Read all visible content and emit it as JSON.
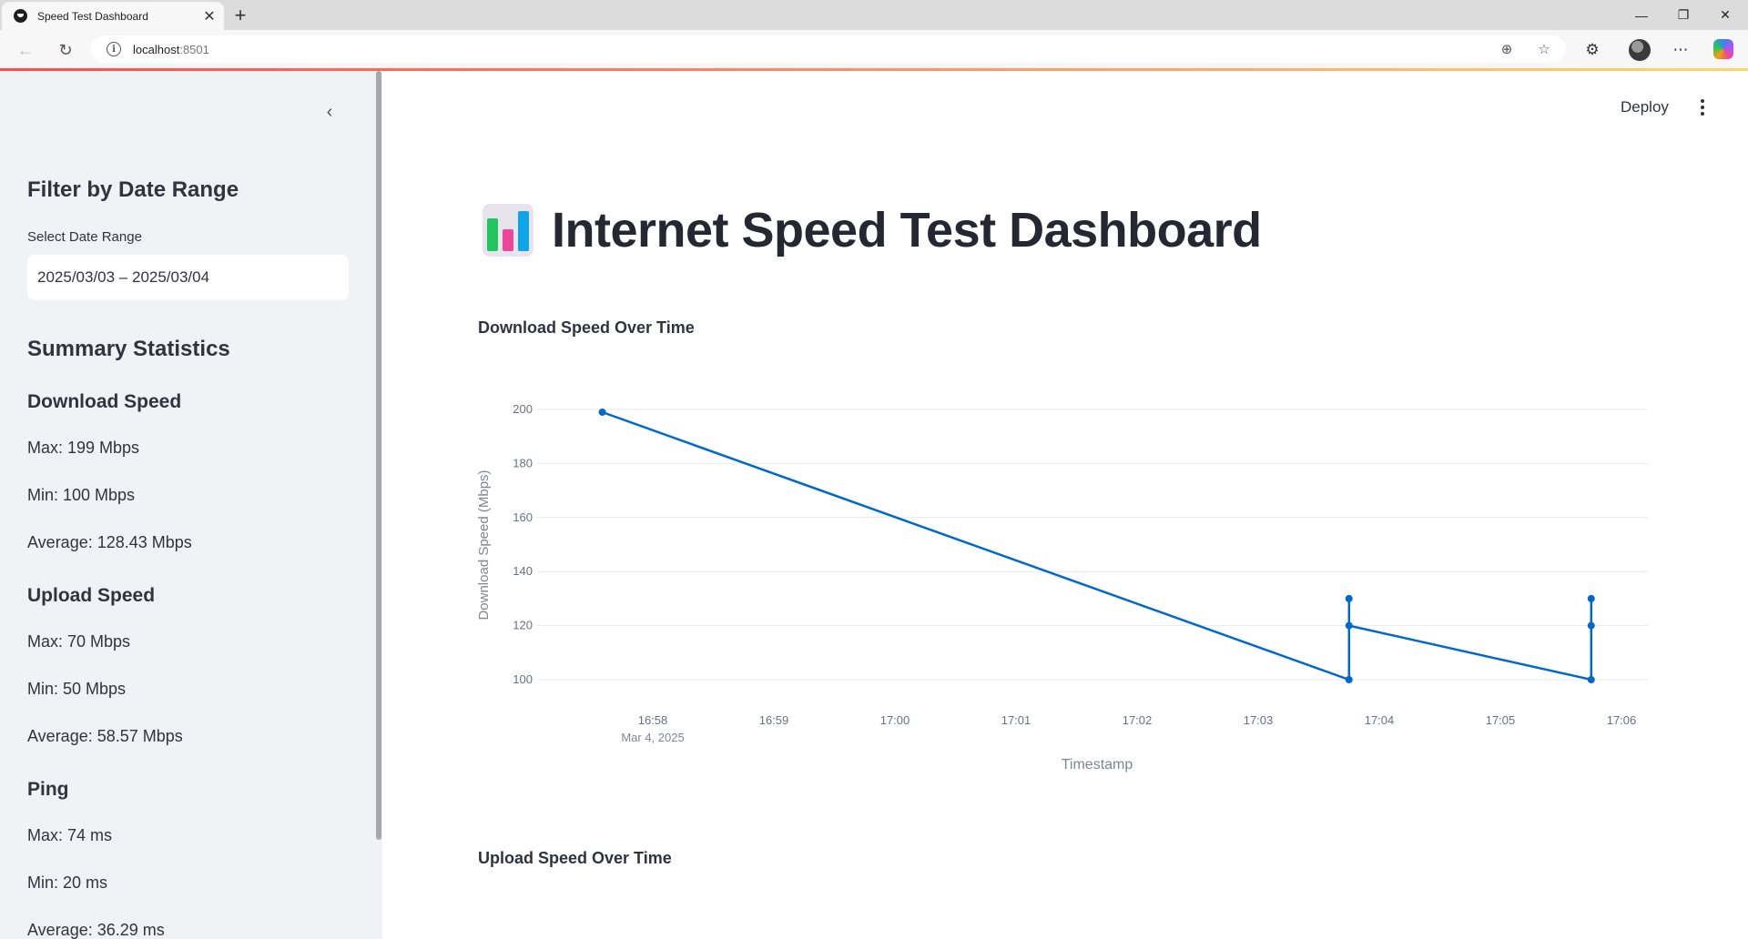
{
  "browser": {
    "tab_title": "Speed Test Dashboard",
    "tab_close": "✕",
    "new_tab": "+",
    "url_host": "localhost",
    "url_port": ":8501",
    "window_controls": {
      "minimize": "—",
      "restore": "❐",
      "close": "✕"
    }
  },
  "sidebar": {
    "collapse_glyph": "‹",
    "filter_heading": "Filter by Date Range",
    "date_label": "Select Date Range",
    "date_value": "2025/03/03 – 2025/03/04",
    "summary_heading": "Summary Statistics",
    "download": {
      "heading": "Download Speed",
      "max": "Max: 199 Mbps",
      "min": "Min: 100 Mbps",
      "avg": "Average: 128.43 Mbps"
    },
    "upload": {
      "heading": "Upload Speed",
      "max": "Max: 70 Mbps",
      "min": "Min: 50 Mbps",
      "avg": "Average: 58.57 Mbps"
    },
    "ping": {
      "heading": "Ping",
      "max": "Max: 74 ms",
      "min": "Min: 20 ms",
      "avg": "Average: 36.29 ms"
    }
  },
  "main": {
    "deploy_label": "Deploy",
    "title": "Internet Speed Test Dashboard",
    "download_chart_title": "Download Speed Over Time",
    "upload_chart_title": "Upload Speed Over Time"
  },
  "colors": {
    "line": "#0068c9",
    "accent": "#ff4b4b",
    "sidebar_bg": "#f0f2f6"
  },
  "chart_data": {
    "type": "line",
    "title": "Download Speed Over Time",
    "xlabel": "Timestamp",
    "ylabel": "Download Speed (Mbps)",
    "ylim": [
      100,
      200
    ],
    "yticks": [
      100,
      120,
      140,
      160,
      180,
      200
    ],
    "xticks": [
      "16:58",
      "16:59",
      "17:00",
      "17:01",
      "17:02",
      "17:03",
      "17:04",
      "17:05",
      "17:06"
    ],
    "xtick_sublabel": "Mar 4, 2025",
    "grid": true,
    "series": [
      {
        "x": [
          "16:57:35",
          "17:03:45",
          "17:03:45",
          "17:03:45",
          "17:05:45",
          "17:05:45",
          "17:05:45"
        ],
        "values": [
          199,
          100,
          130,
          120,
          100,
          130,
          120
        ]
      }
    ]
  }
}
